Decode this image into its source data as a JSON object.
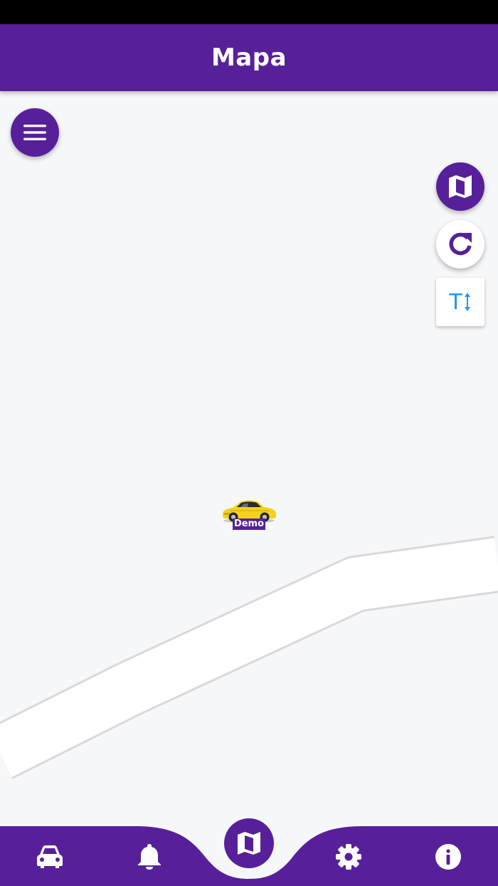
{
  "header": {
    "title": "Mapa"
  },
  "map": {
    "vehicle": {
      "label": "Demo"
    },
    "controls": {
      "menu_icon": "menu-icon",
      "map_type_icon": "map-icon",
      "refresh_icon": "refresh-icon",
      "text_size_icon": "text-size-icon",
      "text_size_label": "T"
    }
  },
  "bottom_nav": {
    "items": [
      {
        "icon": "car-icon"
      },
      {
        "icon": "bell-icon"
      },
      {
        "icon": "map-icon",
        "active": true
      },
      {
        "icon": "gear-icon"
      },
      {
        "icon": "info-icon"
      }
    ]
  },
  "colors": {
    "primary": "#57209a",
    "map_background": "#f6f7f9",
    "road": "#ffffff",
    "text_size_accent": "#2196f3",
    "vehicle_body": "#f2d21c"
  }
}
